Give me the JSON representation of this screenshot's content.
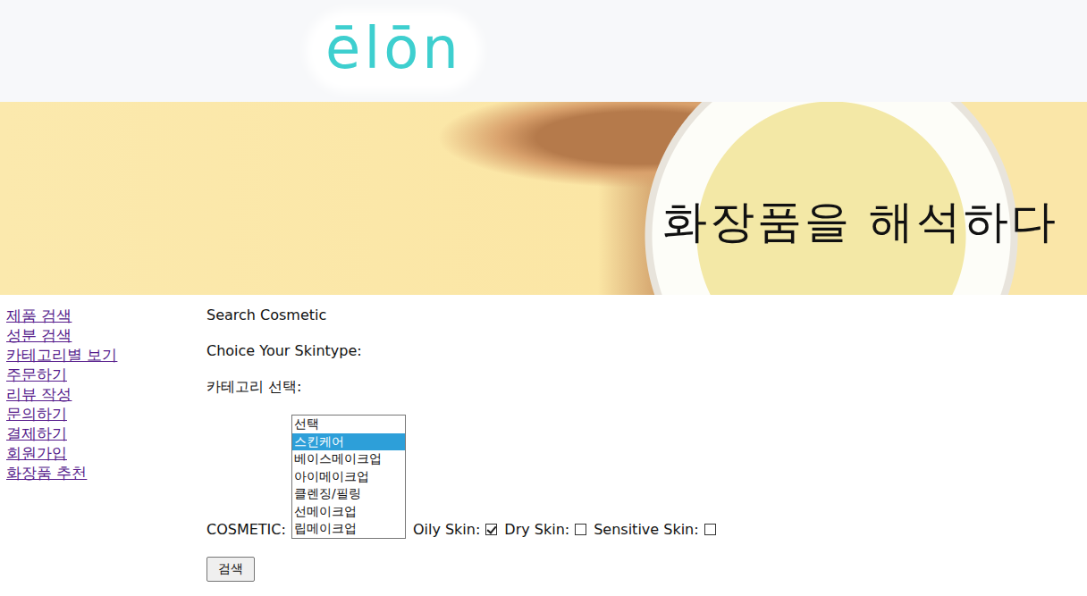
{
  "logo": "ēlōn",
  "banner": {
    "title": "화장품을 해석하다"
  },
  "sidebar": {
    "items": [
      "제품 검색",
      "성분 검색",
      "카테고리별 보기",
      "주문하기",
      "리뷰 작성",
      "문의하기",
      "결제하기",
      "회원가입",
      "화장품 추천"
    ]
  },
  "form": {
    "title": "Search Cosmetic",
    "skintype_label": "Choice Your Skintype:",
    "category_label": "카테고리 선택:",
    "cosmetic_label": "COSMETIC:",
    "categories": [
      {
        "label": "선택",
        "selected": false
      },
      {
        "label": "스킨케어",
        "selected": true
      },
      {
        "label": "베이스메이크업",
        "selected": false
      },
      {
        "label": "아이메이크업",
        "selected": false
      },
      {
        "label": "클렌징/필링",
        "selected": false
      },
      {
        "label": "선메이크업",
        "selected": false
      },
      {
        "label": "립메이크업",
        "selected": false
      }
    ],
    "skin_types": [
      {
        "label": "Oily Skin:",
        "checked": true
      },
      {
        "label": "Dry Skin:",
        "checked": false
      },
      {
        "label": "Sensitive Skin:",
        "checked": false
      }
    ],
    "submit": "검색"
  }
}
